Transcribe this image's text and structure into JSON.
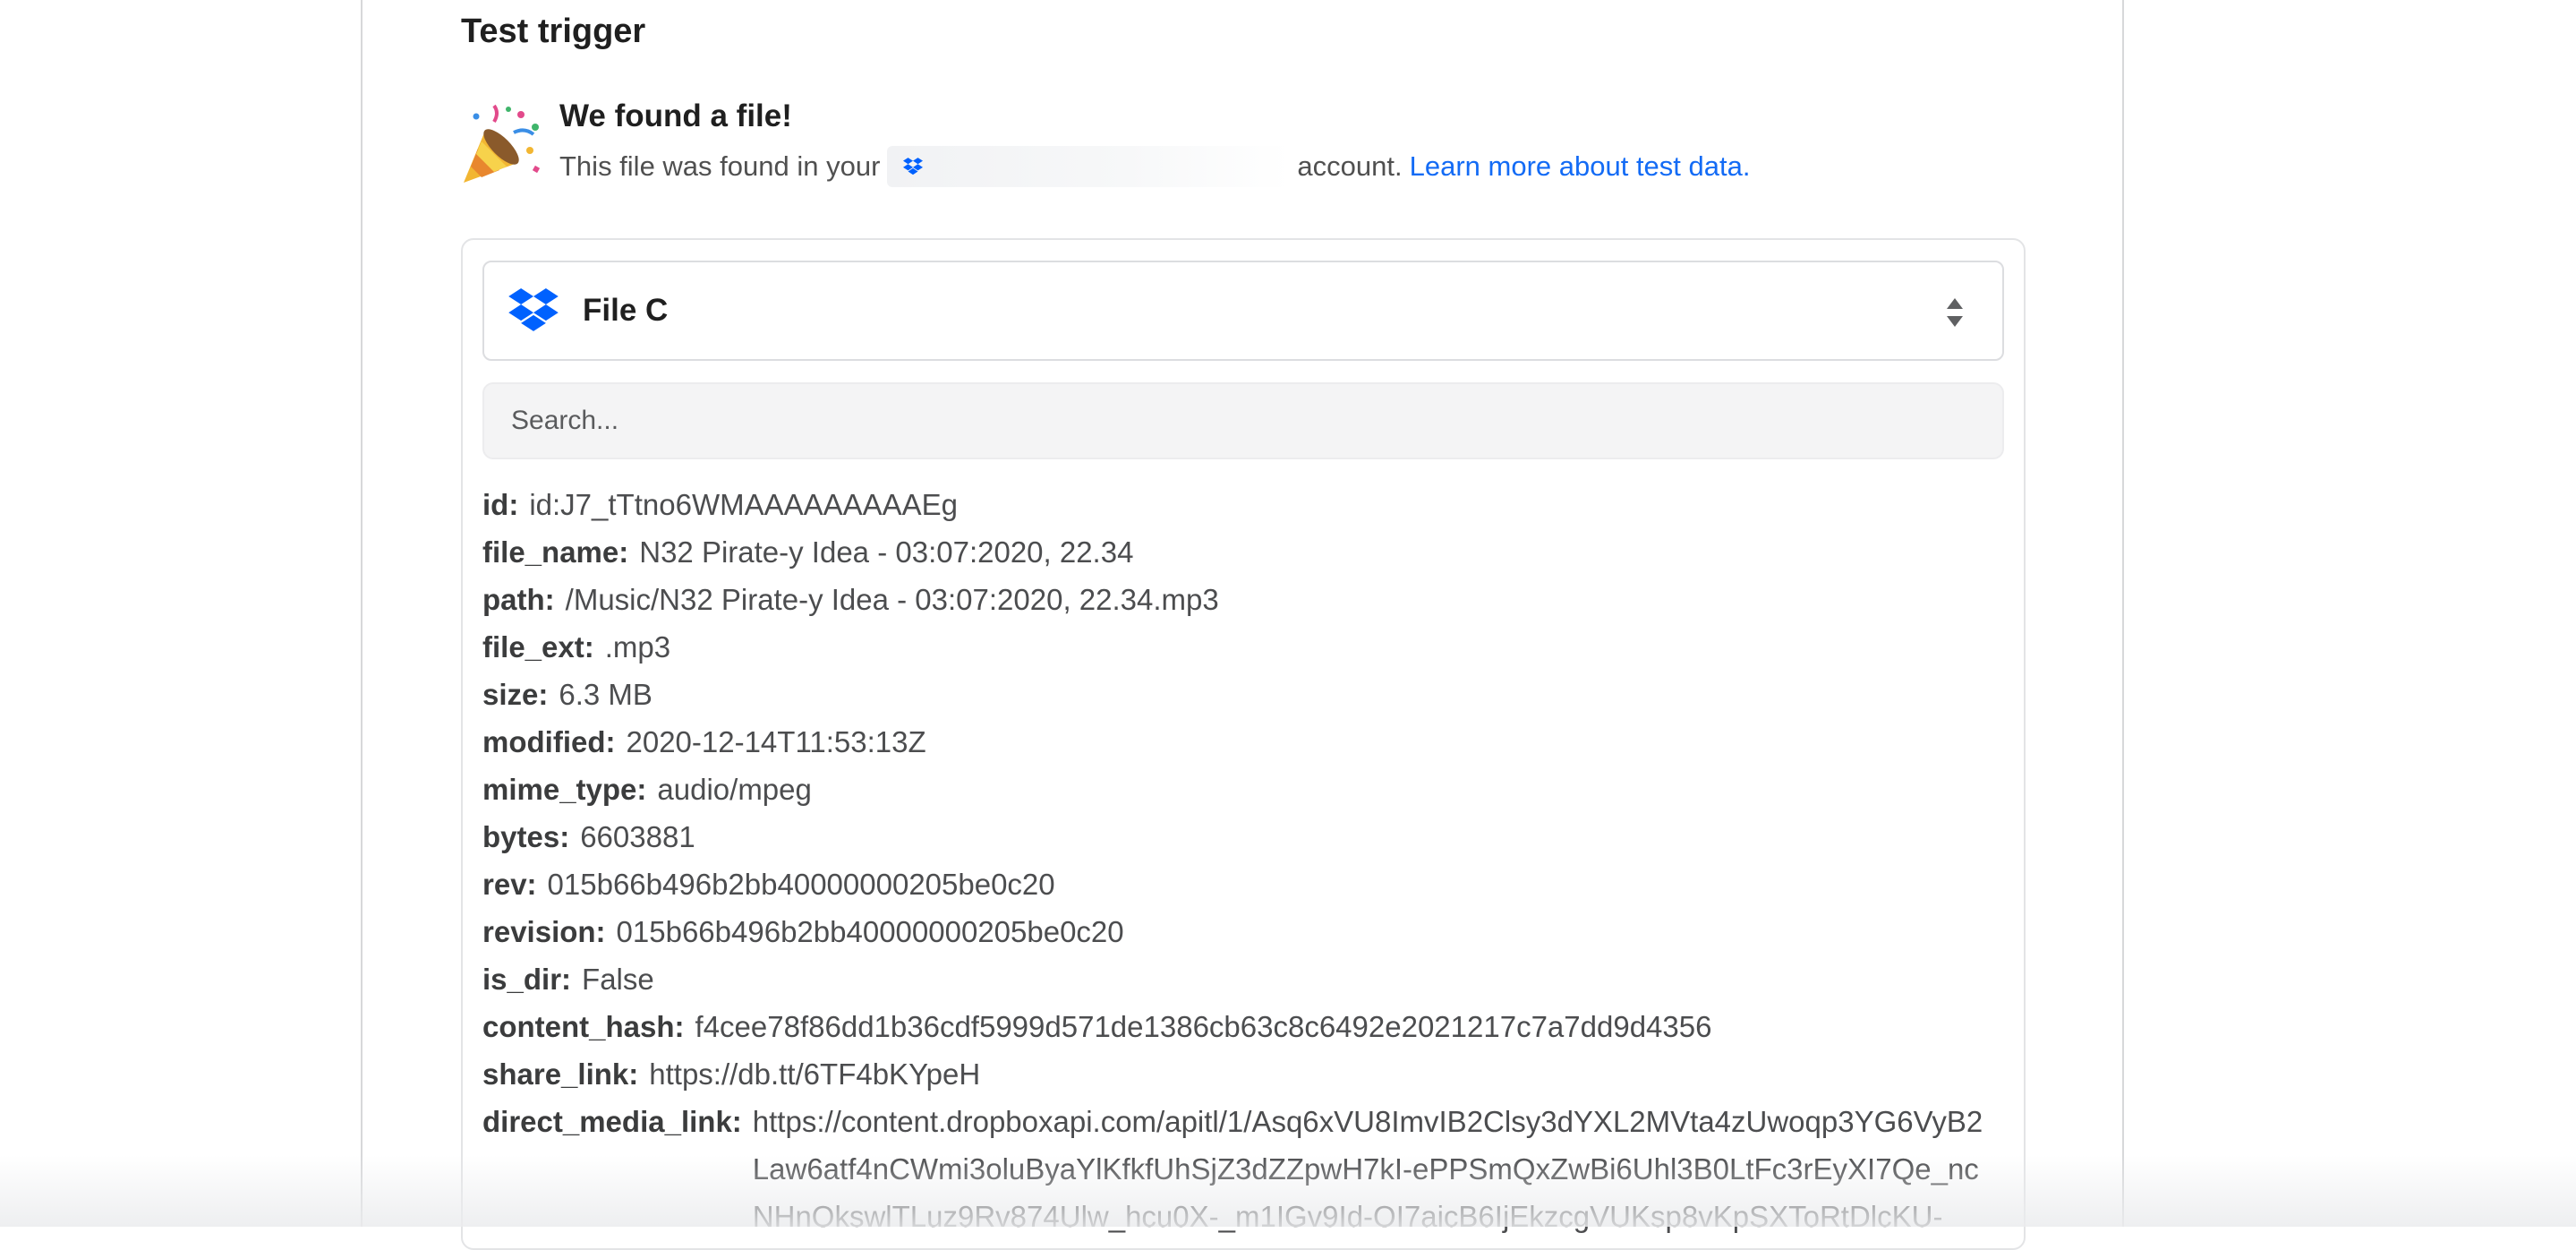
{
  "header": {
    "title": "Test trigger"
  },
  "found": {
    "title": "We found a file!",
    "text_before": "This file was found in your",
    "text_after": "account.",
    "link": "Learn more about test data."
  },
  "file_select": {
    "value": "File C"
  },
  "search": {
    "placeholder": "Search..."
  },
  "fields": [
    {
      "key": "id:",
      "value": "id:J7_tTtno6WMAAAAAAAAAEg"
    },
    {
      "key": "file_name:",
      "value": "N32 Pirate-y Idea - 03:07:2020, 22.34"
    },
    {
      "key": "path:",
      "value": "/Music/N32 Pirate-y Idea - 03:07:2020, 22.34.mp3"
    },
    {
      "key": "file_ext:",
      "value": ".mp3"
    },
    {
      "key": "size:",
      "value": "6.3 MB"
    },
    {
      "key": "modified:",
      "value": "2020-12-14T11:53:13Z"
    },
    {
      "key": "mime_type:",
      "value": "audio/mpeg"
    },
    {
      "key": "bytes:",
      "value": "6603881"
    },
    {
      "key": "rev:",
      "value": "015b66b496b2bb40000000205be0c20"
    },
    {
      "key": "revision:",
      "value": "015b66b496b2bb40000000205be0c20"
    },
    {
      "key": "is_dir:",
      "value": "False"
    },
    {
      "key": "content_hash:",
      "value": "f4cee78f86dd1b36cdf5999d571de1386cb63c8c6492e2021217c7a7dd9d4356"
    },
    {
      "key": "share_link:",
      "value": "https://db.tt/6TF4bKYpeH"
    },
    {
      "key": "direct_media_link:",
      "value": "https://content.dropboxapi.com/apitl/1/Asq6xVU8ImvIB2Clsy3dYXL2MVta4zUwoqp3YG6VyB2Law6atf4nCWmi3oluByaYlKfkfUhSjZ3dZZpwH7kI-ePPSmQxZwBi6Uhl3B0LtFc3rEyXI7Qe_ncNHnOkswlTLuz9Rv874Ulw_hcu0X-_m1IGv9Id-OI7aicB6IjEkzcgVUKsp8vKpSXToRtDlcKU-"
    }
  ],
  "colors": {
    "link": "#136bf5",
    "dropbox": "#0061fe"
  },
  "icons": [
    "party-popper-icon",
    "dropbox-icon",
    "updown-chevron-icon"
  ]
}
